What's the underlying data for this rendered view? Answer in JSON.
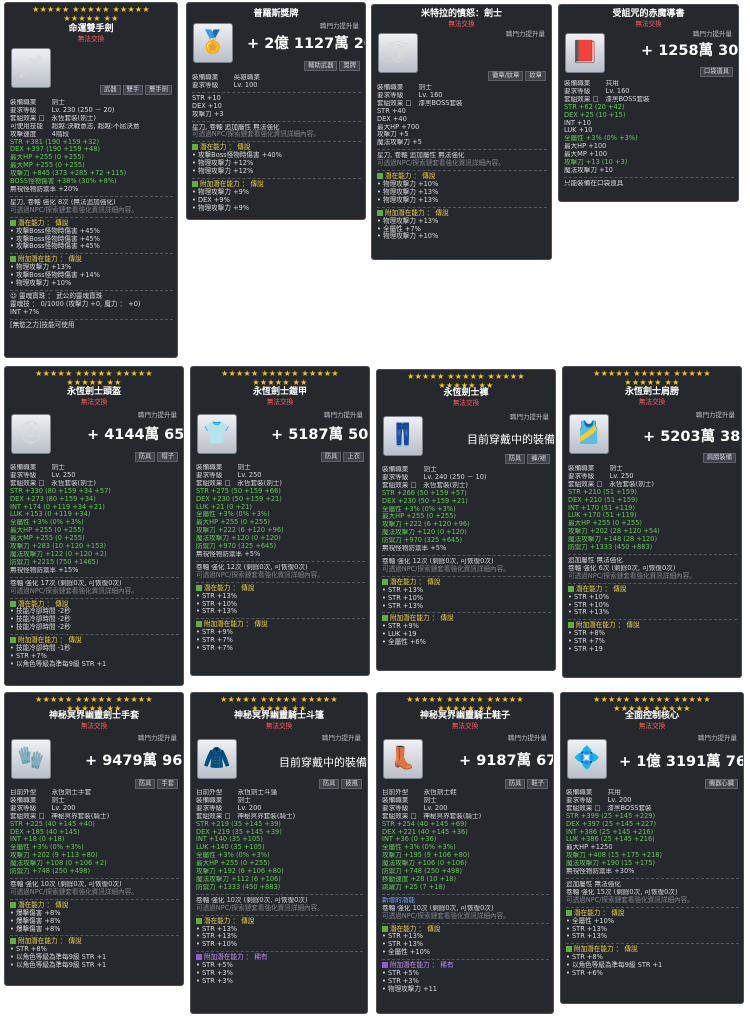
{
  "common": {
    "upgrade_label": "職門力提升量"
  },
  "cards": [
    {
      "id": "c1",
      "stars": "★★★★★ ★★★★★ ★★★★★",
      "stars2": "★★★★★ ★★",
      "name": "命運雙手劍",
      "sub": "無法交換",
      "icon": "🗡",
      "power_prefix": "",
      "power": "",
      "tags": [
        "武器",
        "雙手",
        "雙手劍"
      ],
      "stats": [
        "裝備職業　　 劍士",
        "要求等級　　 Lv. 230 (250 － 20)",
        "套組效果 □　永恆套裝(劍士)",
        "可使用技能　 超越:決戰意志, 超越:不屈決意",
        "攻擊速度　　 4階段",
        "STR +381 (190 +159 +32)",
        "DEX +397 (190 +159 +48)",
        "最大HP +255 (0 +255)",
        "最大MP +255 (0 +255)",
        "攻擊力 +845 (373 +285 +72 +115)",
        "BOSS怪物傷害 +38% (30% +8%)",
        "無視怪物防禦率 +20%"
      ],
      "notes": [
        "星力, 卷軸 強化 8次 (無法追加強化)",
        "可透過NPC/探索鏈套看強化資訊詳細內容。"
      ],
      "pot_title": "潛在能力 ： 傳說",
      "pot_lines": [
        "攻擊Boss怪物時傷害 +45%",
        "攻擊Boss怪物時傷害 +45%",
        "攻擊Boss怪物時傷害 +45%"
      ],
      "bonus_title": "附加潛在能力 ： 傳說",
      "bonus_lines": [
        "物理攻擊力 +13%",
        "攻擊Boss怪物時傷害 +14%",
        "物理攻擊力 +10%"
      ],
      "extra": [
        "☺ 靈魂寶珠 ： 武公的靈魂寶珠",
        "靈魂技 ： 0/1000 (攻擊力 +0, 魔力 ： +0)",
        "INT +7%",
        "[無慾之力]技能可使用"
      ]
    },
    {
      "id": "c2",
      "stars": "",
      "stars2": "",
      "name": "普羅斯獎牌",
      "sub": "",
      "icon": "🏅",
      "power_prefix": "+ 2億",
      "power": "1127萬 2003",
      "tags": [
        "輔助武器",
        "獎牌"
      ],
      "stats": [
        "裝備職業　　 英雄職業",
        "要求等級　　 Lv. 100",
        "STR +10",
        "DEX +10",
        "攻擊力 +3",
        "星力, 卷軸 追加屬性 無法強化",
        "可透過NPC/探索鏈套看強化資訊詳細內容。"
      ],
      "notes": [],
      "pot_title": "潛在能力 ： 傳說",
      "pot_lines": [
        "攻擊Boss怪物時傷害 +40%",
        "物理攻擊力 +12%",
        "物理攻擊力 +12%"
      ],
      "bonus_title": "附加潛在能力 ： 傳說",
      "bonus_lines": [
        "物理攻擊力 +9%",
        "DEX +9%",
        "物理攻擊力 +9%"
      ],
      "extra": []
    },
    {
      "id": "c3",
      "stars": "",
      "stars2": "",
      "name": "米特拉的憤怒：劍士",
      "sub": "無法交換",
      "icon": "🛡",
      "power_prefix": "",
      "power": "",
      "tags": [
        "徽章/紋章",
        "紋章"
      ],
      "stats": [
        "裝備職業　　 劍士",
        "要求等級　　 Lv. 160",
        "套組效果 □　漆黑BOSS套裝",
        "STR +40",
        "DEX +40",
        "最大HP +700",
        "攻擊力 +5",
        "魔法攻擊力 +5",
        "星力, 卷軸 追加屬性 無法強化",
        "可透過NPC/探索鏈套看強化資訊詳細內容。"
      ],
      "notes": [],
      "pot_title": "潛在能力 ： 傳說",
      "pot_lines": [
        "物理攻擊力 +10%",
        "物理攻擊力 +13%",
        "物理攻擊力 +13%"
      ],
      "bonus_title": "附加潛在能力 ： 傳說",
      "bonus_lines": [
        "物理攻擊力 +13%",
        "全屬性 +7%",
        "物理攻擊力 +10%"
      ],
      "extra": []
    },
    {
      "id": "c4",
      "stars": "",
      "stars2": "",
      "name": "受詛咒的赤魔導書",
      "sub": "無法交換",
      "icon": "📕",
      "power_prefix": "+",
      "power": "1258萬 3047",
      "tags": [
        "口袋道具"
      ],
      "stats": [
        "裝備職業　　 共用",
        "要求等級　　 Lv. 160",
        "套組效果 □　漆黑BOSS套裝",
        "STR +62 (20 +42)",
        "DEX +25 (10 +15)",
        "INT +10",
        "LUK +10",
        "全屬性 +3% (0% +3%)",
        "最大HP +100",
        "最大MP +100",
        "攻擊力 +13 (10 +3)",
        "魔法攻擊力 +10",
        "只能裝備在口袋道具"
      ],
      "notes": [],
      "pot_title": "",
      "pot_lines": [],
      "bonus_title": "",
      "bonus_lines": [],
      "extra": []
    },
    {
      "id": "c5",
      "stars": "★★★★★ ★★★★★ ★★★★★",
      "stars2": "★★★★★ ★★",
      "name": "永恆劍士頭盔",
      "sub": "無法交換",
      "icon": "⛑",
      "power_prefix": "+",
      "power": "4144萬 6501",
      "tags": [
        "防具",
        "帽子"
      ],
      "stats": [
        "裝備職業　　 劍士",
        "要求等級　　 Lv. 250",
        "套組效果 □　永恆套裝(劍士)",
        "STR +330 (80 +159 +34 +57)",
        "DEX +273 (80 +159 +34)",
        "INT +174 (0 +119 +34 +21)",
        "LUK +153 (0 +119 +34)",
        "全屬性 +3% (0% +3%)",
        "最大HP +255 (0 +255)",
        "最大MP +255 (0 +255)",
        "攻擊力 +283 (10 +120 +153)",
        "魔法攻擊力 +122 (0 +120 +2)",
        "防禦力 +2215 (750 +1465)",
        "無視怪物防禦率 +15%"
      ],
      "notes": [
        "卷軸 強化 17次 (剩餘0次, 可恢復0次)",
        "可透過NPC/探索鏈套看強化資訊詳細內容。"
      ],
      "pot_title": "潛在能力 ： 傳說",
      "pot_lines": [
        "技能冷卻時間 -2秒",
        "技能冷卻時間 -2秒",
        "技能冷卻時間 -2秒"
      ],
      "bonus_title": "附加潛在能力 ： 傳說",
      "bonus_lines": [
        "技能冷卻時間 -1秒",
        "STR +7%",
        "以角色等級為準每9級 STR +1"
      ],
      "extra": []
    },
    {
      "id": "c6",
      "stars": "★★★★★ ★★★★★ ★★★★★",
      "stars2": "★★★★★ ★★",
      "name": "永恆劍士鎧甲",
      "sub": "無法交換",
      "icon": "👕",
      "power_prefix": "+",
      "power": "5187萬 5076",
      "tags": [
        "防具",
        "上衣"
      ],
      "stats": [
        "裝備職業　　 劍士",
        "要求等級　　 Lv. 250",
        "套組效果 □　永恆套裝(劍士)",
        "STR +275 (50 +159 +66)",
        "DEX +230 (50 +159 +21)",
        "LUK +21 (0 +21)",
        "全屬性 +3% (0% +3%)",
        "最大HP +255 (0 +255)",
        "攻擊力 +222 (6 +120 +96)",
        "魔法攻擊力 +120 (0 +120)",
        "防禦力 +970 (325 +645)",
        "無視怪物防禦率 +5%"
      ],
      "notes": [
        "卷軸 強化 12次 (剩餘0次, 可恢復0次)",
        "可透過NPC/探索鏈套看強化資訊詳細內容。"
      ],
      "pot_title": "潛在能力 ： 傳說",
      "pot_lines": [
        "STR +13%",
        "STR +10%",
        "STR +13%"
      ],
      "bonus_title": "附加潛在能力 ： 傳說",
      "bonus_lines": [
        "STR +9%",
        "STR +7%",
        "STR +7%"
      ],
      "extra": []
    },
    {
      "id": "c7",
      "stars": "★★★★★ ★★★★★ ★★★★★",
      "stars2": "★★★★★ ★★",
      "name": "永恆劍士褲",
      "sub": "無法交換",
      "icon": "👖",
      "power_prefix": "",
      "power": "目前穿戴中的裝備",
      "tags": [
        "防具",
        "褲/裙"
      ],
      "stats": [
        "裝備職業　　 劍士",
        "要求等級　　 Lv. 240 (250 － 10)",
        "套組效果 □　永恆套裝(劍士)",
        "STR +266 (50 +159 +57)",
        "DEX +230 (50 +159 +21)",
        "全屬性 +3% (0% +3%)",
        "最大HP +255 (0 +255)",
        "攻擊力 +222 (6 +120 +96)",
        "魔法攻擊力 +120 (0 +120)",
        "防禦力 +970 (325 +645)",
        "無視怪物防禦率 +5%"
      ],
      "notes": [
        "卷軸 強化 12次 (剩餘0次, 可恢復0次)",
        "可透過NPC/探索鏈套看強化資訊詳細內容。"
      ],
      "pot_title": "潛在能力 ： 傳說",
      "pot_lines": [
        "STR +13%",
        "STR +10%",
        "STR +13%"
      ],
      "bonus_title": "附加潛在能力 ： 傳說",
      "bonus_lines": [
        "STR +9%",
        "LUK +19",
        "全屬性 +6%"
      ],
      "extra": []
    },
    {
      "id": "c8",
      "stars": "★★★★★ ★★★★★ ★★★★★",
      "stars2": "★★★★★ ★★",
      "name": "永恆劍士肩膀",
      "sub": "無法交換",
      "icon": "🎽",
      "power_prefix": "+",
      "power": "5203萬 3833",
      "tags": [
        "肩膀裝備"
      ],
      "stats": [
        "裝備職業　　 劍士",
        "要求等級　　 Lv. 250",
        "套組效果 □　永恆套裝(劍士)",
        "STR +210 (51 +159)",
        "DEX +210 (51 +159)",
        "INT +170 (51 +119)",
        "LUK +170 (51 +119)",
        "最大HP +255 (0 +255)",
        "攻擊力 +202 (28 +120 +54)",
        "魔法攻擊力 +148 (28 +120)",
        "防禦力 +1333 (450 +883)"
      ],
      "notes": [
        "追加屬性 無法強化",
        "卷軸 強化 6次 (剩餘0次, 可恢復0次)",
        "可透過NPC/探索鏈套看強化資訊詳細內容。"
      ],
      "pot_title": "潛在能力 ： 傳說",
      "pot_lines": [
        "STR +10%",
        "STR +10%",
        "STR +13%"
      ],
      "bonus_title": "附加潛在能力 ： 傳說",
      "bonus_lines": [
        "STR +8%",
        "STR +7%",
        "STR +19"
      ],
      "extra": []
    },
    {
      "id": "c9",
      "stars": "★★★★★ ★★★★★ ★★★★★",
      "stars2": "★★★★★ ★★",
      "name": "神秘冥界幽靈劍士手套",
      "sub": "無法交換",
      "icon": "🧤",
      "power_prefix": "+",
      "power": "9479萬 9611",
      "tags": [
        "防具",
        "手套"
      ],
      "stats": [
        "目前外型　　 永恆劍士手套",
        "裝備職業　　 劍士",
        "要求等級　　 Lv. 200",
        "套組效果 □　神秘冥界套裝(騎士)",
        "STR +225 (40 +145 +40)",
        "DEX +185 (40 +145)",
        "INT +18 (0 +18)",
        "全屬性 +3% (0% +3%)",
        "攻擊力 +202 (9 +113 +80)",
        "魔法攻擊力 +108 (0 +106 +2)",
        "防禦力 +748 (250 +498)"
      ],
      "notes": [
        "卷軸 強化 10次 (剩餘0次, 可恢復0次)",
        "可透過NPC/探索鏈套看強化資訊詳細內容。"
      ],
      "pot_title": "潛在能力 ： 傳說",
      "pot_lines": [
        "爆擊傷害 +8%",
        "爆擊傷害 +8%",
        "爆擊傷害 +8%"
      ],
      "bonus_title": "附加潛在能力 ： 傳說",
      "bonus_lines": [
        "STR +8%",
        "以角色等級為準每9級 STR +1",
        "以角色等級為準每9級 STR +1"
      ],
      "extra": []
    },
    {
      "id": "c10",
      "stars": "★★★★★ ★★★★★ ★★★★★",
      "stars2": "★★★★★ ★★",
      "name": "神秘冥界幽靈騎士斗篷",
      "sub": "無法交換",
      "icon": "🧥",
      "power_prefix": "",
      "power": "目前穿戴中的裝備",
      "tags": [
        "防具",
        "披風"
      ],
      "stats": [
        "目前外型　　 永恆劍士斗篷",
        "裝備職業　　 劍士",
        "要求等級　　 Lv. 200",
        "套組效果 □　神秘冥界套裝(騎士)",
        "STR +219 (35 +145 +39)",
        "DEX +219 (35 +145 +39)",
        "INT +140 (35 +105)",
        "LUK +140 (35 +105)",
        "全屬性 +3% (0% +3%)",
        "最大HP +255 (0 +255)",
        "攻擊力 +192 (6 +106 +80)",
        "魔法攻擊力 +112 (6 +106)",
        "防禦力 +1333 (450 +883)"
      ],
      "notes": [
        "卷軸 強化 10次 (剩餘0次, 可恢復0次)",
        "可透過NPC/探索鏈套看強化資訊詳細內容。"
      ],
      "pot_title": "潛在能力 ： 傳說",
      "pot_lines": [
        "STR +13%",
        "STR +13%",
        "STR +10%"
      ],
      "bonus_title": "附加潛在能力 ： 稀有",
      "bonus_lines": [
        "STR +5%",
        "STR +3%",
        "STR +3%"
      ],
      "extra": []
    },
    {
      "id": "c11",
      "stars": "★★★★★ ★★★★★ ★★★★★",
      "stars2": "★★★★★ ★★",
      "name": "神秘冥界幽靈騎士鞋子",
      "sub": "無法交換",
      "icon": "👢",
      "power_prefix": "+",
      "power": "9187萬 6761",
      "tags": [
        "防具",
        "鞋子"
      ],
      "stats": [
        "目前外型　　 永恆劍士鞋",
        "裝備職業　　 劍士",
        "要求等級　　 Lv. 200",
        "套組效果 □　神秘冥界套裝(騎士)",
        "STR +254 (40 +145 +69)",
        "DEX +221 (40 +145 +36)",
        "INT +36 (0 +36)",
        "全屬性 +3% (0% +3%)",
        "攻擊力 +195 (9 +106 +80)",
        "魔法攻擊力 +106 (0 +106)",
        "防禦力 +748 (250 +498)",
        "移動速度 +28 (10 +18)",
        "跳躍力 +25 (7 +18)"
      ],
      "notes": [
        "新增的潛能",
        "卷軸 強化 10次 (剩餘0次, 可恢復0次)",
        "可透過NPC/探索鏈套看強化資訊詳細內容。"
      ],
      "pot_title": "潛在能力 ： 傳說",
      "pot_lines": [
        "STR +13%",
        "STR +13%",
        "全屬性 +10%"
      ],
      "bonus_title": "附加潛在能力 ： 稀有",
      "bonus_lines": [
        "STR +5%",
        "STR +3%",
        "物理攻擊力 +11"
      ],
      "extra": []
    },
    {
      "id": "c12",
      "stars": "★★★★★ ★★★★★ ★★★★★",
      "stars2": "★★★★★ ★★★★★",
      "name": "全面控制核心",
      "sub": "無法交換",
      "icon": "💠",
      "power_prefix": "+ 1億",
      "power": "3191萬 7645",
      "tags": [
        "機器心臟"
      ],
      "stats": [
        "裝備職業　　 共用",
        "要求等級　　 Lv. 200",
        "套組效果 □　漆黑BOSS套裝",
        "STR +399 (25 +145 +229)",
        "DEX +397 (25 +145 +227)",
        "INT +386 (25 +145 +216)",
        "LUK +386 (25 +145 +216)",
        "最大HP +1250",
        "攻擊力 +408 (15 +175 +218)",
        "魔法攻擊力 +190 (15 +175)",
        "無視怪物防禦率 +30%"
      ],
      "notes": [
        "追加屬性 無法強化",
        "卷軸 強化 15次 (剩餘0次, 可恢復0次)",
        "可透過NPC/探索鏈套看強化資訊詳細內容。"
      ],
      "pot_title": "潛在能力 ： 傳說",
      "pot_lines": [
        "全屬性 +10%",
        "STR +13%",
        "STR +13%"
      ],
      "bonus_title": "附加潛在能力 ： 傳說",
      "bonus_lines": [
        "STR +8%",
        "以角色等級為準每9級 STR +1",
        "STR +6%"
      ],
      "extra": []
    }
  ]
}
